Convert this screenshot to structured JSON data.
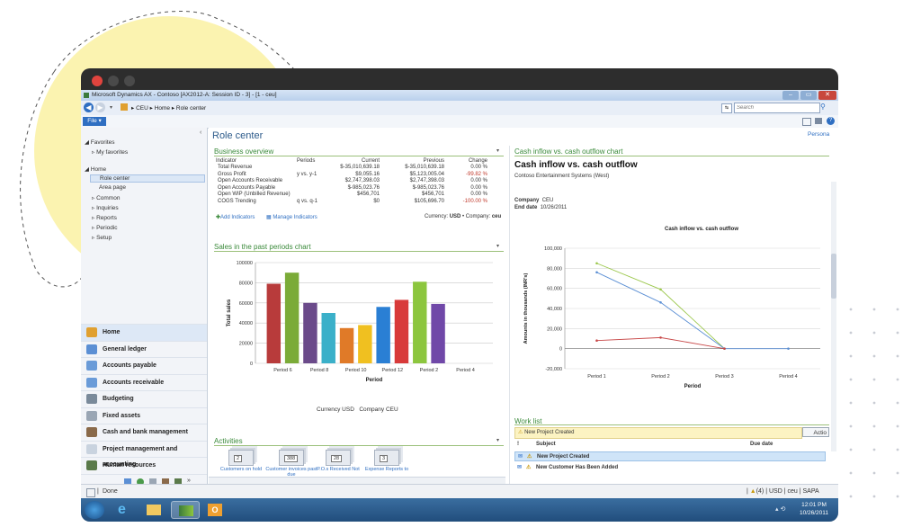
{
  "window": {
    "title": "Microsoft Dynamics AX - Contoso [AX2012-A: Session ID - 3] - [1 - ceu]",
    "breadcrumb": [
      "CEU",
      "Home",
      "Role center"
    ],
    "search_placeholder": "Search",
    "file_menu": "File"
  },
  "nav": {
    "favorites": "Favorites",
    "my_favorites": "My favorites",
    "home": "Home",
    "items": [
      "Role center",
      "Area page",
      "Common",
      "Inquiries",
      "Reports",
      "Periodic",
      "Setup"
    ],
    "modules": [
      "Home",
      "General ledger",
      "Accounts payable",
      "Accounts receivable",
      "Budgeting",
      "Fixed assets",
      "Cash and bank management",
      "Project management and accounting",
      "Human resources"
    ]
  },
  "page": {
    "title": "Role center",
    "personalize": "Persona"
  },
  "business_overview": {
    "title": "Business overview",
    "headers": [
      "Indicator",
      "Periods",
      "Current",
      "Previous",
      "Change"
    ],
    "rows": [
      [
        "Total Revenue",
        "",
        "$-35,010,639.18",
        "$-35,010,639.18",
        "0.00 %"
      ],
      [
        "Gross Profit",
        "y vs. y-1",
        "$9,055.16",
        "$5,123,005.04",
        "-99.82 %"
      ],
      [
        "Open Accounts Receivable",
        "",
        "$2,747,398.03",
        "$2,747,398.03",
        "0.00 %"
      ],
      [
        "Open Accounts Payable",
        "",
        "$-985,023.76",
        "$-985,023.76",
        "0.00 %"
      ],
      [
        "Open WIP (Unbilled Revenue)",
        "",
        "$456,701",
        "$456,701",
        "0.00 %"
      ],
      [
        "COGS Trending",
        "q vs. q-1",
        "$0",
        "$105,696.70",
        "-100.00 %"
      ]
    ],
    "add_indicators": "Add Indicators",
    "manage_indicators": "Manage Indicators",
    "currency_label": "Currency:",
    "currency": "USD",
    "company_label": "Company:",
    "company": "ceu"
  },
  "cash_panel": {
    "title": "Cash inflow vs. cash outflow chart",
    "heading": "Cash inflow vs. cash outflow",
    "company_name": "Contoso Entertainment Systems (West)",
    "company_label": "Company",
    "company": "CEU",
    "end_date_label": "End date",
    "end_date": "10/26/2011"
  },
  "sales_panel": {
    "title": "Sales in the past periods chart",
    "footer_currency": "Currency  USD",
    "footer_company": "Company  CEU"
  },
  "activities": {
    "title": "Activities",
    "cues": [
      {
        "label": "Customers on hold",
        "count": "2"
      },
      {
        "label": "Customer invoices past due",
        "count": "388"
      },
      {
        "label": "P.O.s Received Not",
        "count": "28"
      },
      {
        "label": "Expense Reports to",
        "count": "3"
      }
    ]
  },
  "work_list": {
    "title": "Work list",
    "banner": "New Project Created",
    "action": "Actio",
    "col_flag": "!",
    "col_subject": "Subject",
    "col_due": "Due date",
    "items": [
      "New Project Created",
      "New Customer Has Been Added"
    ]
  },
  "status_bar": {
    "status": "Done",
    "notifications": "(4)",
    "currency": "USD",
    "company": "ceu",
    "user": "SAPA"
  },
  "taskbar": {
    "time": "12:01 PM",
    "date": "10/26/2011"
  },
  "colors": {
    "accent_green": "#3a8a3a",
    "nav_bg": "#f2f4f8",
    "taskbar": "#214d7c"
  },
  "chart_data": [
    {
      "type": "bar",
      "categories": [
        "Period 6",
        "Period 8",
        "Period 10",
        "Period 12",
        "Period 2",
        "Period 4"
      ],
      "bars": [
        {
          "category": "Period 6",
          "value": 79000,
          "color": "#b83b3b"
        },
        {
          "category": "Period 6",
          "value": 90000,
          "color": "#7bab38"
        },
        {
          "category": "Period 8",
          "value": 60000,
          "color": "#6b4a8a"
        },
        {
          "category": "Period 8",
          "value": 50000,
          "color": "#3bb0c9"
        },
        {
          "category": "Period 10",
          "value": 35000,
          "color": "#e07a28"
        },
        {
          "category": "Period 10",
          "value": 38000,
          "color": "#f0c020"
        },
        {
          "category": "Period 12",
          "value": 56000,
          "color": "#2a7fd4"
        },
        {
          "category": "Period 12",
          "value": 63000,
          "color": "#d83a3a"
        },
        {
          "category": "Period 2",
          "value": 81000,
          "color": "#8cc63e"
        },
        {
          "category": "Period 2",
          "value": 59000,
          "color": "#7048a8"
        }
      ],
      "title": "",
      "xlabel": "Period",
      "ylabel": "Total sales",
      "ylim": [
        0,
        100000
      ],
      "yticks": [
        "0",
        "20000",
        "40000",
        "60000",
        "80000",
        "100000"
      ]
    },
    {
      "type": "line",
      "title": "Cash inflow vs. cash outflow",
      "x": [
        "Period 1",
        "Period 2",
        "Period 3",
        "Period 4"
      ],
      "series": [
        {
          "values": [
            85000,
            59000,
            0,
            null
          ],
          "color": "#9bc74b"
        },
        {
          "values": [
            76000,
            46000,
            0,
            0
          ],
          "color": "#5b8fd4"
        },
        {
          "values": [
            8000,
            11000,
            0,
            null
          ],
          "color": "#c84848"
        }
      ],
      "xlabel": "Period",
      "ylabel": "Amounts in thousands (INR's)",
      "ylim": [
        -20000,
        100000
      ],
      "yticks": [
        "-20,000",
        "0",
        "20,000",
        "40,000",
        "60,000",
        "80,000",
        "100,000"
      ]
    }
  ]
}
